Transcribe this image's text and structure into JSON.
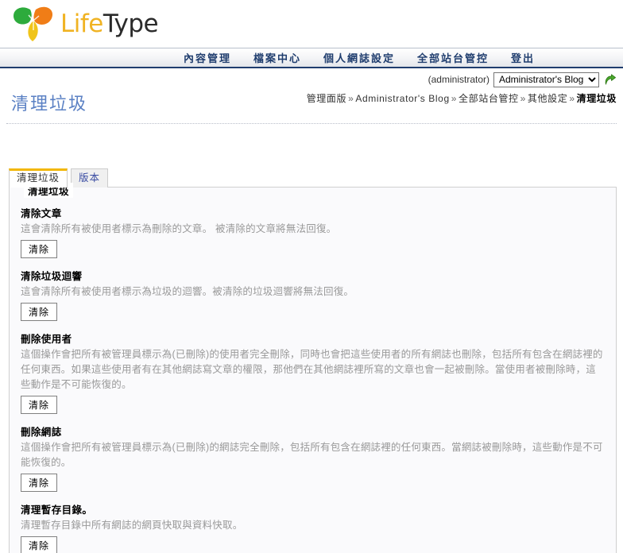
{
  "brand": {
    "name_part1": "Life",
    "name_part2": "Type",
    "leaf_colors": [
      "#2dab3c",
      "#f07d17",
      "#f0c419"
    ]
  },
  "nav": {
    "items": [
      {
        "label": "內容管理",
        "name": "nav-content-management"
      },
      {
        "label": "檔案中心",
        "name": "nav-file-center"
      },
      {
        "label": "個人網誌設定",
        "name": "nav-blog-settings"
      },
      {
        "label": "全部站台管控",
        "name": "nav-site-admin"
      },
      {
        "label": "登出",
        "name": "nav-logout"
      }
    ],
    "accent": "#1f3d6e"
  },
  "blogbar": {
    "admin_label": "(administrator)",
    "selected_blog": "Administrator's Blog",
    "options": [
      "Administrator's Blog"
    ],
    "go_icon": "go-arrow-icon"
  },
  "page": {
    "title": "清理垃圾",
    "title_color": "#5b81c4"
  },
  "breadcrumb": {
    "separator": "»",
    "items": [
      {
        "label": "管理面版",
        "current": false
      },
      {
        "label": "Administrator's Blog",
        "current": false
      },
      {
        "label": "全部站台管控",
        "current": false
      },
      {
        "label": "其他設定",
        "current": false
      },
      {
        "label": "清理垃圾",
        "current": true
      }
    ]
  },
  "tabs": [
    {
      "label": "清理垃圾",
      "active": true
    },
    {
      "label": "版本",
      "active": false
    }
  ],
  "panel": {
    "legend": "清理垃圾",
    "sections": [
      {
        "title": "清除文章",
        "desc": "這會清除所有被使用者標示為刪除的文章。 被清除的文章將無法回復。",
        "button": "清除"
      },
      {
        "title": "清除垃圾迴響",
        "desc": "這會清除所有被使用者標示為垃圾的迴響。被清除的垃圾迴響將無法回復。",
        "button": "清除"
      },
      {
        "title": "刪除使用者",
        "desc": "這個操作會把所有被管理員標示為(已刪除)的使用者完全刪除，同時也會把這些使用者的所有網誌也刪除，包括所有包含在網誌裡的任何東西。如果這些使用者有在其他網誌寫文章的權限，那他們在其他網誌裡所寫的文章也會一起被刪除。當使用者被刪除時，這些動作是不可能恢復的。",
        "button": "清除"
      },
      {
        "title": "刪除網誌",
        "desc": "這個操作會把所有被管理員標示為(已刪除)的網誌完全刪除，包括所有包含在網誌裡的任何東西。當網誌被刪除時，這些動作是不可能恢復的。",
        "button": "清除"
      },
      {
        "title": "清理暫存目錄。",
        "desc": "清理暫存目錄中所有網誌的網頁快取與資料快取。",
        "button": "清除"
      }
    ]
  }
}
